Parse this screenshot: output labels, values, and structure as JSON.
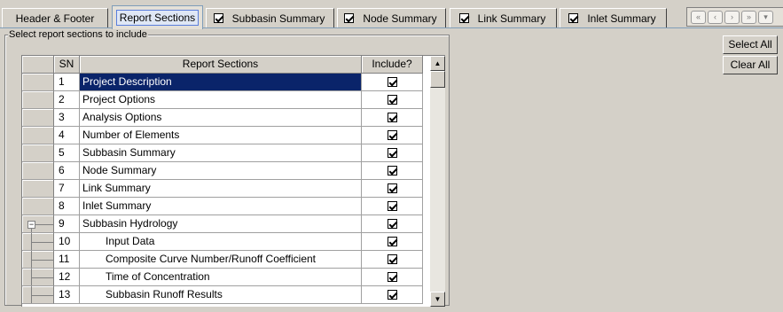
{
  "tabs": [
    {
      "label": "Header & Footer",
      "has_checkbox": false,
      "checked": false,
      "active": false
    },
    {
      "label": "Report Sections",
      "has_checkbox": false,
      "checked": false,
      "active": true
    },
    {
      "label": "Subbasin Summary",
      "has_checkbox": true,
      "checked": true,
      "active": false
    },
    {
      "label": "Node Summary",
      "has_checkbox": true,
      "checked": true,
      "active": false
    },
    {
      "label": "Link Summary",
      "has_checkbox": true,
      "checked": true,
      "active": false
    },
    {
      "label": "Inlet Summary",
      "has_checkbox": true,
      "checked": true,
      "active": false
    }
  ],
  "nav_icons": [
    "first-page-icon",
    "previous-page-icon",
    "next-page-icon",
    "last-page-icon",
    "dropdown-icon"
  ],
  "group": {
    "legend": "Select report sections to include"
  },
  "grid": {
    "headers": {
      "sn": "SN",
      "section": "Report Sections",
      "include": "Include?"
    },
    "rows": [
      {
        "sn": "1",
        "section": "Project Description",
        "include": true,
        "selected": true,
        "level": 0
      },
      {
        "sn": "2",
        "section": "Project Options",
        "include": true,
        "selected": false,
        "level": 0
      },
      {
        "sn": "3",
        "section": "Analysis Options",
        "include": true,
        "selected": false,
        "level": 0
      },
      {
        "sn": "4",
        "section": "Number of Elements",
        "include": true,
        "selected": false,
        "level": 0
      },
      {
        "sn": "5",
        "section": "Subbasin Summary",
        "include": true,
        "selected": false,
        "level": 0
      },
      {
        "sn": "6",
        "section": "Node Summary",
        "include": true,
        "selected": false,
        "level": 0
      },
      {
        "sn": "7",
        "section": "Link Summary",
        "include": true,
        "selected": false,
        "level": 0
      },
      {
        "sn": "8",
        "section": "Inlet Summary",
        "include": true,
        "selected": false,
        "level": 0
      },
      {
        "sn": "9",
        "section": "Subbasin Hydrology",
        "include": true,
        "selected": false,
        "level": 0,
        "tree": "parent"
      },
      {
        "sn": "10",
        "section": "Input Data",
        "include": true,
        "selected": false,
        "level": 1,
        "tree": "child"
      },
      {
        "sn": "11",
        "section": "Composite Curve Number/Runoff Coefficient",
        "include": true,
        "selected": false,
        "level": 1,
        "tree": "child"
      },
      {
        "sn": "12",
        "section": "Time of Concentration",
        "include": true,
        "selected": false,
        "level": 1,
        "tree": "child"
      },
      {
        "sn": "13",
        "section": "Subbasin Runoff Results",
        "include": true,
        "selected": false,
        "level": 1,
        "tree": "child"
      }
    ]
  },
  "buttons": {
    "select_all": "Select All",
    "clear_all": "Clear All"
  },
  "expander_glyph": "−",
  "scroll": {
    "up_glyph": "▲",
    "down_glyph": "▼"
  }
}
